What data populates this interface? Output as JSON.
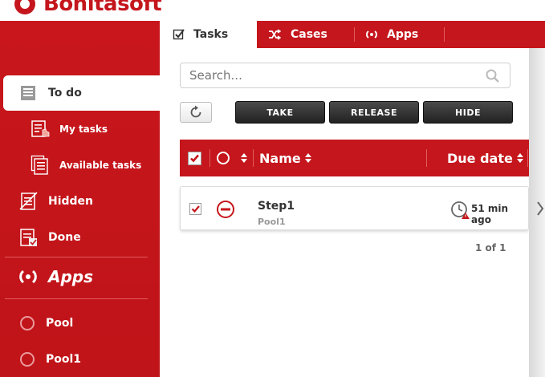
{
  "brand": {
    "name": "Bonitasoft"
  },
  "tabs": [
    {
      "label": "Tasks"
    },
    {
      "label": "Cases"
    },
    {
      "label": "Apps"
    }
  ],
  "sidebar": {
    "todo": "To do",
    "my_tasks": "My tasks",
    "available_tasks": "Available tasks",
    "hidden": "Hidden",
    "done": "Done",
    "apps_heading": "Apps",
    "apps": [
      {
        "label": "Pool"
      },
      {
        "label": "Pool1"
      }
    ]
  },
  "search": {
    "placeholder": "Search..."
  },
  "actions": {
    "take": "TAKE",
    "release": "RELEASE",
    "hide": "HIDE"
  },
  "table": {
    "headers": {
      "name": "Name",
      "due_date": "Due date"
    },
    "rows": [
      {
        "name": "Step1",
        "process": "Pool1",
        "due": "51 min ago"
      }
    ],
    "pager": "1 of 1"
  },
  "colors": {
    "brand_red": "#c4161c",
    "button_dark": "#2b2b2b"
  }
}
